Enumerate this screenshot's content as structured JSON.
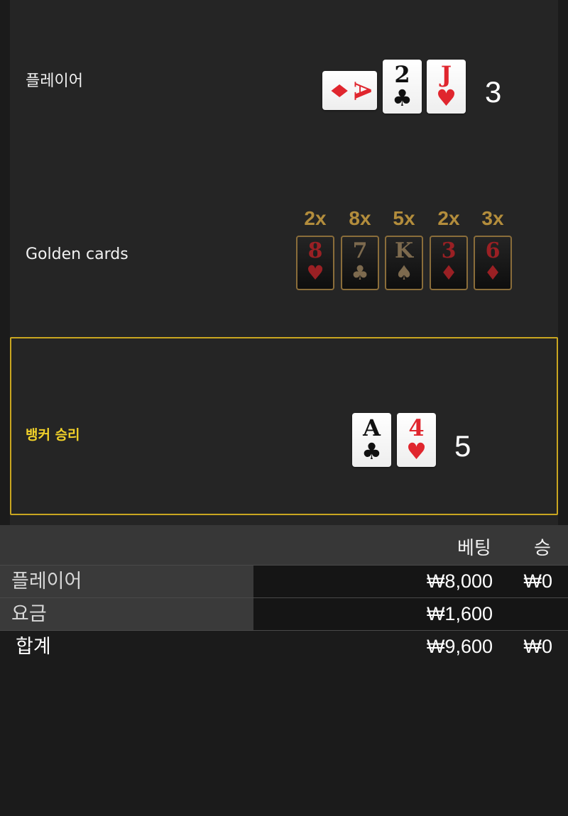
{
  "player": {
    "label": "플레이어",
    "total": "3",
    "cards": [
      {
        "rank": "A",
        "suit": "♦",
        "color": "red",
        "orientation": "sideways"
      },
      {
        "rank": "2",
        "suit": "♣",
        "color": "black"
      },
      {
        "rank": "J",
        "suit": "♥",
        "color": "red"
      }
    ]
  },
  "golden": {
    "label": "Golden cards",
    "cards": [
      {
        "mult": "2x",
        "rank": "8",
        "suit": "♥",
        "color": "red"
      },
      {
        "mult": "8x",
        "rank": "7",
        "suit": "♣",
        "color": "dim"
      },
      {
        "mult": "5x",
        "rank": "K",
        "suit": "♠",
        "color": "dim"
      },
      {
        "mult": "2x",
        "rank": "3",
        "suit": "♦",
        "color": "red"
      },
      {
        "mult": "3x",
        "rank": "6",
        "suit": "♦",
        "color": "red"
      }
    ]
  },
  "banker": {
    "label": "뱅커 승리",
    "total": "5",
    "cards": [
      {
        "rank": "A",
        "suit": "♣",
        "color": "black"
      },
      {
        "rank": "4",
        "suit": "♥",
        "color": "red"
      }
    ]
  },
  "table": {
    "headers": {
      "bet": "베팅",
      "win": "승"
    },
    "rows": [
      {
        "label": "플레이어",
        "bet": "₩8,000",
        "win": "₩0"
      },
      {
        "label": "요금",
        "bet": "₩1,600",
        "win": ""
      }
    ],
    "total": {
      "label": "합계",
      "bet": "₩9,600",
      "win": "₩0"
    }
  },
  "colors": {
    "highlight": "#c9a620",
    "banker_label": "#f2d22a",
    "gold_multiplier": "#b38d3c",
    "card_red": "#e0262e"
  }
}
